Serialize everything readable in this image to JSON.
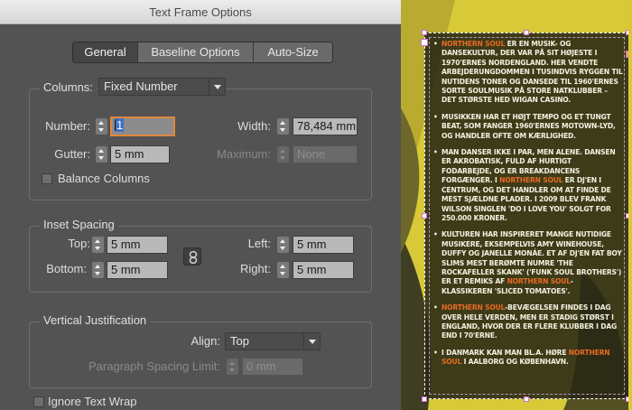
{
  "dialog": {
    "title": "Text Frame Options",
    "tabs": [
      "General",
      "Baseline Options",
      "Auto-Size"
    ],
    "active_tab": "General",
    "columns": {
      "legend": "Columns:",
      "type_value": "Fixed Number",
      "number_label": "Number:",
      "number_value": "1",
      "width_label": "Width:",
      "width_value": "78,484 mm",
      "gutter_label": "Gutter:",
      "gutter_value": "5 mm",
      "maximum_label": "Maximum:",
      "maximum_value": "None",
      "balance_label": "Balance Columns"
    },
    "inset": {
      "legend": "Inset Spacing",
      "top_label": "Top:",
      "top_value": "5 mm",
      "bottom_label": "Bottom:",
      "bottom_value": "5 mm",
      "left_label": "Left:",
      "left_value": "5 mm",
      "right_label": "Right:",
      "right_value": "5 mm"
    },
    "vjust": {
      "legend": "Vertical Justification",
      "align_label": "Align:",
      "align_value": "Top",
      "spacing_label": "Paragraph Spacing Limit:",
      "spacing_value": "0 mm"
    },
    "ignore_wrap_label": "Ignore Text Wrap"
  },
  "document": {
    "paragraphs": [
      [
        {
          "t": "Northern Soul",
          "h": true
        },
        {
          "t": " er en musik- og dansekultur, der var på sit højeste i 1970'ernes Nordengland. Her vendte arbejderungdommen i tusindvis ryggen til nutidens toner og dansede til 1960'ernes sorte soulmusik på store natklubber – det største hed Wigan Casino."
        }
      ],
      [
        {
          "t": "Musikken har et højt tempo og et tungt beat, som fanger 1960'ernes Motown-lyd, og handler ofte om kærlighed."
        }
      ],
      [
        {
          "t": "Man danser ikke i par, men alene. Dansen er akrobatisk, fuld af hurtigt fodarbejde, og er breakdancens forgænger. I "
        },
        {
          "t": "Northern Soul",
          "h": true
        },
        {
          "t": " er DJ'en i centrum, og det handler om at finde de mest sjældne plader. I 2009 blev Frank Wilson singlen 'Do I Love You' solgt for 250.000 kroner."
        }
      ],
      [
        {
          "t": "Kulturen har inspireret mange nutidige musikere, eksempelvis Amy Winehouse, Duffy og Janelle Monáe. Et af DJ'en Fat Boy Slims mest berømte numre 'The Rockafeller Skank' ('Funk Soul Brothers') er et remiks af "
        },
        {
          "t": "Northern Soul",
          "h": true
        },
        {
          "t": "-klassikeren 'Sliced Tomatoes'."
        }
      ],
      [
        {
          "t": "Northern Soul",
          "h": true
        },
        {
          "t": "-bevægelsen findes i dag over hele verden, men er stadig størst i England, hvor der er flere klubber i dag end i 70'erne."
        }
      ],
      [
        {
          "t": "I Danmark kan man bl.a. høre "
        },
        {
          "t": "Northern Soul",
          "h": true
        },
        {
          "t": " i Aalborg og København."
        }
      ]
    ],
    "colors": {
      "highlight": "#e86a24",
      "background": "#d7c938",
      "frame_fill": "#262614"
    }
  }
}
